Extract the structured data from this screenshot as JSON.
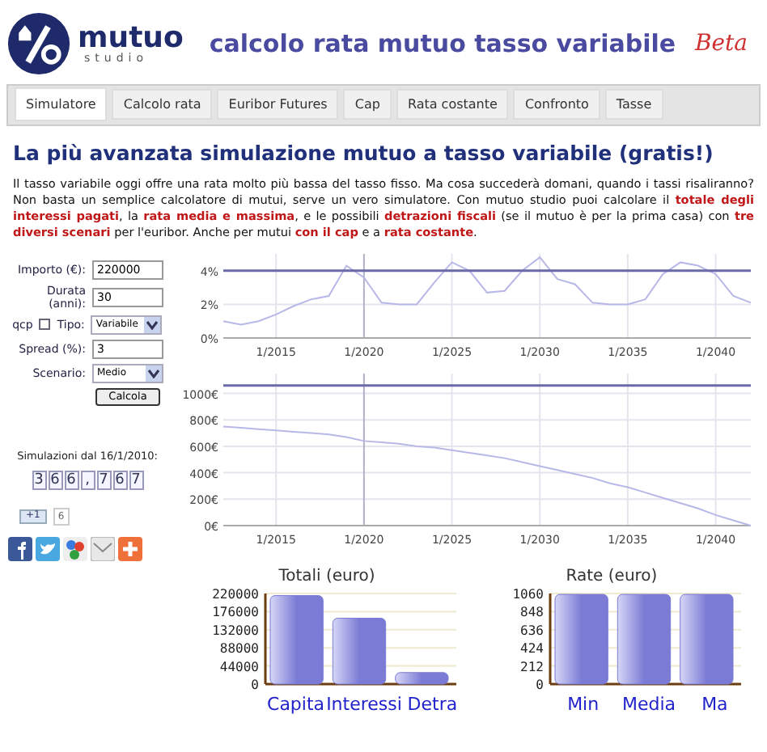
{
  "header": {
    "logo_word": "mutuo",
    "logo_sub": "studio",
    "title": "calcolo rata mutuo tasso variabile",
    "badge": "Beta"
  },
  "tabs": [
    {
      "label": "Simulatore",
      "selected": true
    },
    {
      "label": "Calcolo rata",
      "selected": false
    },
    {
      "label": "Euribor Futures",
      "selected": false
    },
    {
      "label": "Cap",
      "selected": false
    },
    {
      "label": "Rata costante",
      "selected": false
    },
    {
      "label": "Confronto",
      "selected": false
    },
    {
      "label": "Tasse",
      "selected": false
    }
  ],
  "heading": "La più avanzata simulazione mutuo a tasso variabile (gratis!)",
  "intro": "Il tasso variabile oggi offre una rata molto più bassa del tasso fisso. Ma cosa succederà domani, quando i tassi risaliranno? Non basta un semplice calcolatore di mutui, serve un vero simulatore. Con mutuo studio puoi calcolare il **totale degli interessi pagati**, la **rata media e massima**, e le possibili **detrazioni fiscali** (se il mutuo è per la prima casa) con **tre diversi scenari** per l'euribor. Anche per mutui **con il cap** e a **rata costante**.",
  "form": {
    "importo": {
      "label": "Importo (€):",
      "value": "220000"
    },
    "durata": {
      "label": "Durata (anni):",
      "value": "30"
    },
    "qcp": {
      "label": "qcp",
      "checked": false
    },
    "tipo": {
      "label": "Tipo:",
      "value": "Variabile"
    },
    "spread": {
      "label": "Spread (%):",
      "value": "3"
    },
    "scenario": {
      "label": "Scenario:",
      "value": "Medio"
    },
    "button": "Calcola"
  },
  "counter": {
    "label": "Simulazioni dal 16/1/2010:",
    "digits": [
      "3",
      "6",
      "6",
      ",",
      "7",
      "6",
      "7"
    ]
  },
  "plusone": {
    "label": "+1",
    "count": "6"
  },
  "charts": [
    {
      "chart_data": {
        "type": "line",
        "grid": true,
        "categories": [
          null,
          null,
          null,
          "1/2015",
          null,
          null,
          null,
          null,
          "1/2020",
          null,
          null,
          null,
          null,
          "1/2025",
          null,
          null,
          null,
          null,
          "1/2030",
          null,
          null,
          null,
          null,
          "1/2035",
          null,
          null,
          null,
          null,
          "1/2040",
          null,
          null
        ],
        "ylim": [
          0,
          5
        ],
        "yticks": [
          {
            "value": 0,
            "label": "0%"
          },
          {
            "value": 2,
            "label": "2%"
          },
          {
            "value": 4,
            "label": "4%"
          }
        ],
        "series": [
          {
            "color": "#b8b8e8",
            "values": [
              1.0,
              0.8,
              1.0,
              1.4,
              1.9,
              2.3,
              2.5,
              4.3,
              3.6,
              2.1,
              2.0,
              2.0,
              3.3,
              4.5,
              4.0,
              2.7,
              2.8,
              4.0,
              4.8,
              3.5,
              3.2,
              2.1,
              2.0,
              2.0,
              2.3,
              3.8,
              4.5,
              4.3,
              3.8,
              2.5,
              2.1
            ]
          },
          {
            "color": "#6a6aa8",
            "values": [
              4,
              4,
              4,
              4,
              4,
              4,
              4,
              4,
              4,
              4,
              4,
              4,
              4,
              4,
              4,
              4,
              4,
              4,
              4,
              4,
              4,
              4,
              4,
              4,
              4,
              4,
              4,
              4,
              4,
              4,
              4
            ]
          }
        ]
      }
    },
    {
      "chart_data": {
        "type": "line",
        "grid": true,
        "categories": [
          null,
          null,
          null,
          "1/2015",
          null,
          null,
          null,
          null,
          "1/2020",
          null,
          null,
          null,
          null,
          "1/2025",
          null,
          null,
          null,
          null,
          "1/2030",
          null,
          null,
          null,
          null,
          "1/2035",
          null,
          null,
          null,
          null,
          "1/2040",
          null,
          null
        ],
        "ylim": [
          0,
          1150
        ],
        "yticks": [
          {
            "value": 0,
            "label": "0€"
          },
          {
            "value": 200,
            "label": "200€"
          },
          {
            "value": 400,
            "label": "400€"
          },
          {
            "value": 600,
            "label": "600€"
          },
          {
            "value": 800,
            "label": "800€"
          },
          {
            "value": 1000,
            "label": "1000€"
          }
        ],
        "series": [
          {
            "color": "#b8b8e8",
            "values": [
              750,
              740,
              730,
              720,
              710,
              700,
              690,
              670,
              640,
              630,
              620,
              600,
              590,
              570,
              550,
              530,
              510,
              480,
              450,
              420,
              390,
              360,
              320,
              290,
              250,
              210,
              170,
              130,
              80,
              40,
              0
            ]
          },
          {
            "color": "#6a6aa8",
            "values": [
              1060,
              1060,
              1060,
              1060,
              1060,
              1060,
              1060,
              1060,
              1060,
              1060,
              1060,
              1060,
              1060,
              1060,
              1060,
              1060,
              1060,
              1060,
              1060,
              1060,
              1060,
              1060,
              1060,
              1060,
              1060,
              1060,
              1060,
              1060,
              1060,
              1060,
              1060
            ]
          }
        ]
      }
    },
    {
      "chart_data": {
        "type": "bar",
        "grid": true,
        "title": "Totali (euro)",
        "categories": [
          "Capita",
          "Interessi",
          "Detra"
        ],
        "ylim": [
          0,
          220000
        ],
        "yticks": [
          0,
          44000,
          88000,
          132000,
          176000,
          220000
        ],
        "series": [
          {
            "color": "#7b7bd6",
            "values": [
              215000,
              160000,
              28000
            ]
          }
        ]
      }
    },
    {
      "chart_data": {
        "type": "bar",
        "grid": true,
        "title": "Rate (euro)",
        "categories": [
          "Min",
          "Media",
          "Ma"
        ],
        "ylim": [
          0,
          1060
        ],
        "yticks": [
          0,
          212,
          424,
          636,
          848,
          1060
        ],
        "series": [
          {
            "color": "#7b7bd6",
            "values": [
              1050,
              1050,
              1050
            ]
          }
        ]
      }
    }
  ]
}
